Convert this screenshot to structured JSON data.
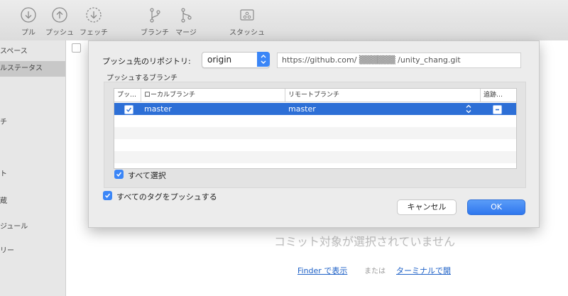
{
  "toolbar": {
    "buttons": [
      {
        "label": "プル",
        "icon": "pull-icon"
      },
      {
        "label": "プッシュ",
        "icon": "push-icon"
      },
      {
        "label": "フェッチ",
        "icon": "fetch-icon"
      },
      {
        "label": "ブランチ",
        "icon": "branch-icon"
      },
      {
        "label": "マージ",
        "icon": "merge-icon"
      },
      {
        "label": "スタッシュ",
        "icon": "stash-icon"
      }
    ]
  },
  "sidebar": {
    "items": [
      "スペース",
      "ルステータス",
      "",
      "チ",
      "",
      "ト",
      "蔵",
      "ジュール",
      "リー"
    ]
  },
  "main": {
    "empty_message": "コミット対象が選択されていません",
    "finder_link": "Finder で表示",
    "or_text": "または",
    "terminal_link": "ターミナルで開"
  },
  "push_sheet": {
    "remote_label": "プッシュ先のリポジトリ:",
    "remote_value": "origin",
    "url_value": "https://github.com/ ▒▒▒▒▒▒ /unity_chang.git",
    "branches_label": "プッシュするブランチ",
    "table": {
      "headers": [
        "プッ…",
        "ローカルブランチ",
        "リモートブランチ",
        "追跡…"
      ],
      "rows": [
        {
          "push": true,
          "local": "master",
          "remote": "master",
          "track": true
        }
      ]
    },
    "select_all_label": "すべて選択",
    "push_tags_label": "すべてのタグをプッシュする",
    "cancel_label": "キャンセル",
    "ok_label": "OK"
  },
  "colors": {
    "accent": "#3b86f7",
    "selection": "#2d6fd6",
    "link": "#1e61c7"
  }
}
